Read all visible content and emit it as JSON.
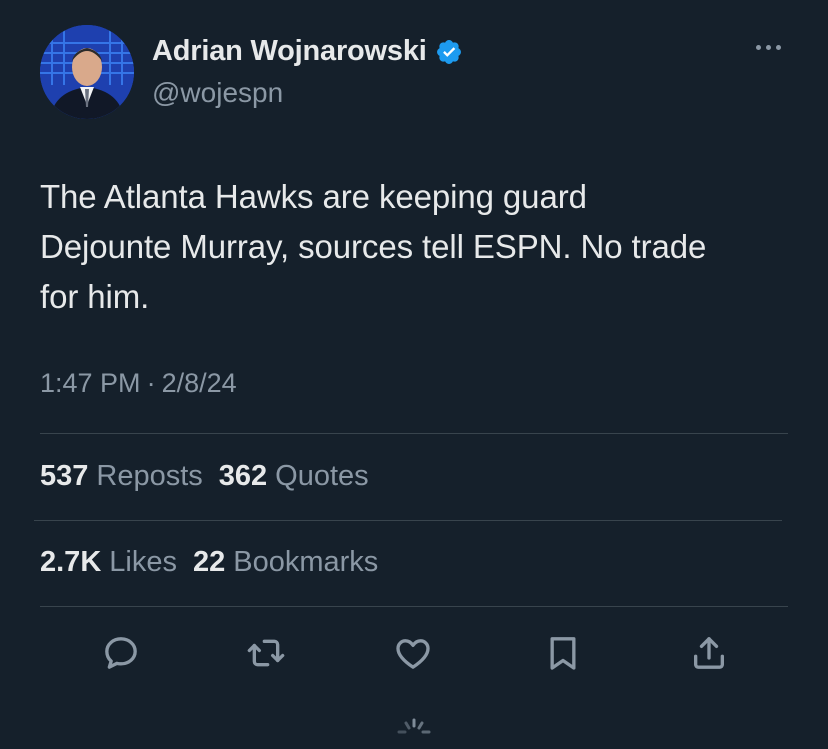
{
  "author": {
    "display_name": "Adrian Wojnarowski",
    "handle": "@wojespn",
    "verified": true
  },
  "tweet": {
    "text": "The Atlanta Hawks are keeping guard\nDejounte Murray, sources tell ESPN. No trade\nfor him.",
    "time": "1:47 PM",
    "separator": "·",
    "date": "2/8/24"
  },
  "stats": {
    "reposts": {
      "count": "537",
      "label": "Reposts"
    },
    "quotes": {
      "count": "362",
      "label": "Quotes"
    },
    "likes": {
      "count": "2.7K",
      "label": "Likes"
    },
    "bookmarks": {
      "count": "22",
      "label": "Bookmarks"
    }
  },
  "actions": [
    "reply-icon",
    "repost-icon",
    "like-icon",
    "bookmark-icon",
    "share-icon"
  ],
  "colors": {
    "background": "#15202b",
    "text": "#e7e9ea",
    "muted": "#8b98a5",
    "divider": "#38444d",
    "verified": "#1d9bf0"
  }
}
